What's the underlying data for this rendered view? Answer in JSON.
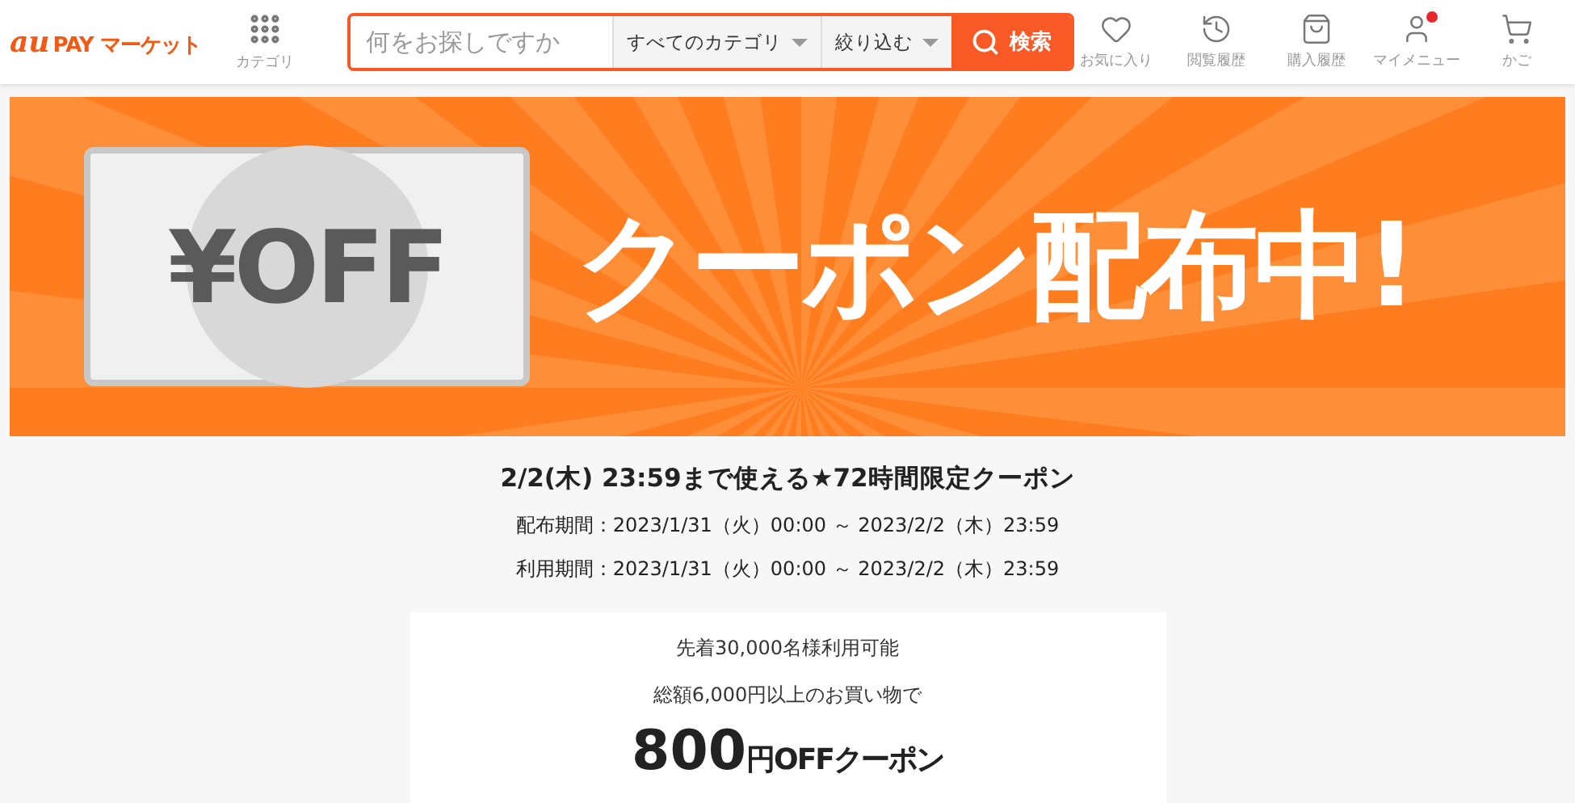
{
  "header": {
    "logo_mark": "au",
    "logo_text": "PAY マーケット",
    "category_label": "カテゴリ",
    "search": {
      "placeholder": "何をお探しですか",
      "category": "すべてのカテゴリ",
      "filter": "絞り込む",
      "button": "検索"
    },
    "nav": [
      {
        "label": "お気に入り",
        "badge": false
      },
      {
        "label": "閲覧履歴",
        "badge": false
      },
      {
        "label": "購入履歴",
        "badge": false
      },
      {
        "label": "マイメニュー",
        "badge": true
      },
      {
        "label": "かご",
        "badge": false
      }
    ]
  },
  "banner": {
    "card_text": "¥OFF",
    "title": "クーポン配布中!"
  },
  "headline": "2/2(木) 23:59まで使える★72時間限定クーポン",
  "periods": [
    "配布期間：2023/1/31（火）00:00 ～ 2023/2/2（木）23:59",
    "利用期間：2023/1/31（火）00:00 ～ 2023/2/2（木）23:59"
  ],
  "coupon": {
    "limit": "先着30,000名様利用可能",
    "condition": "総額6,000円以上のお買い物で",
    "amount": "800",
    "unit": "円OFFクーポン"
  }
}
